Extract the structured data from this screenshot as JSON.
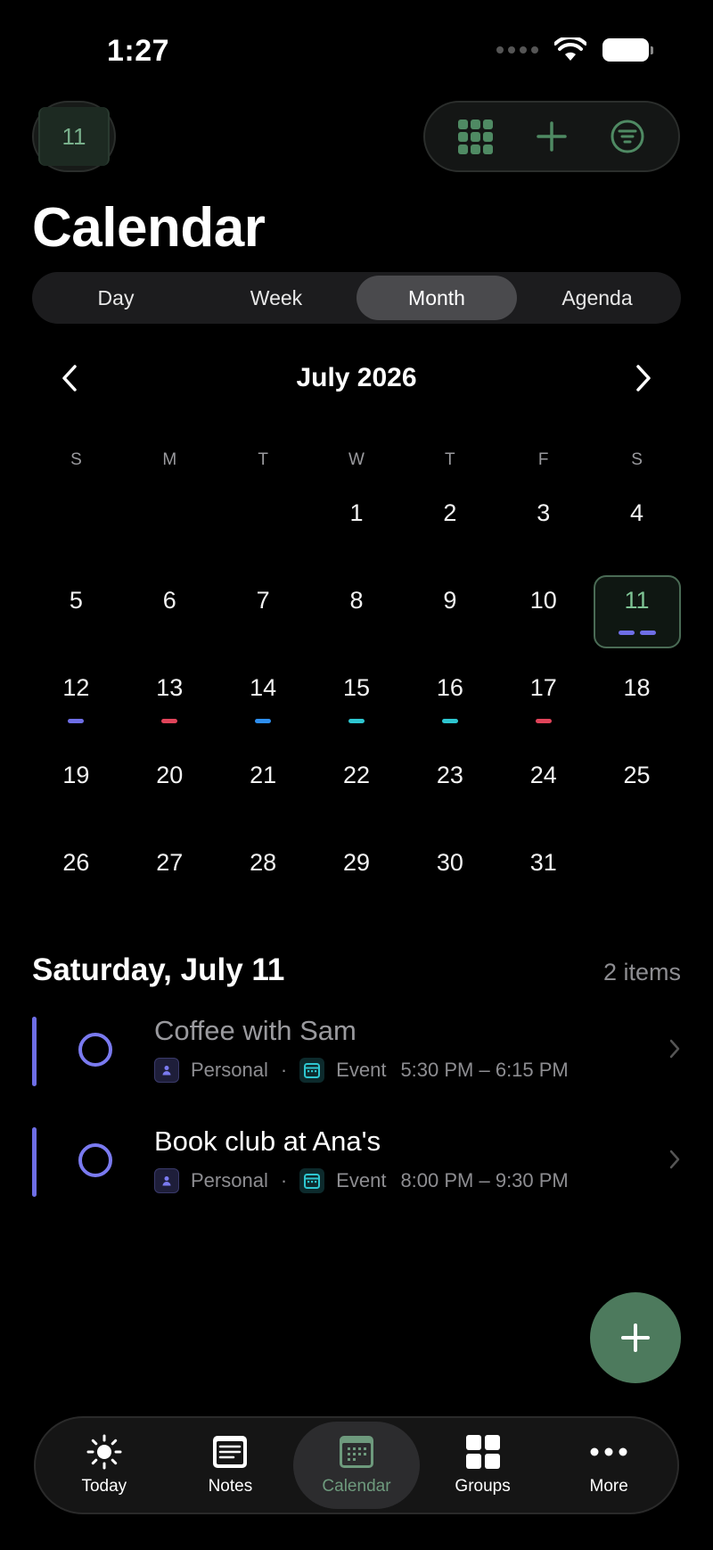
{
  "status_bar": {
    "time": "1:27"
  },
  "header": {
    "day_badge": "11"
  },
  "title": "Calendar",
  "view_tabs": [
    {
      "label": "Day",
      "active": false
    },
    {
      "label": "Week",
      "active": false
    },
    {
      "label": "Month",
      "active": true
    },
    {
      "label": "Agenda",
      "active": false
    }
  ],
  "calendar": {
    "month_label": "July 2026",
    "weekdays": [
      "S",
      "M",
      "T",
      "W",
      "T",
      "F",
      "S"
    ],
    "leading_blanks": 3,
    "days_in_month": 31,
    "selected_day": 11,
    "markers": {
      "11": [
        "#6e6ee6",
        "#6e6ee6"
      ],
      "12": [
        "#6e6ee6"
      ],
      "13": [
        "#e0445a"
      ],
      "14": [
        "#2e8ff0"
      ],
      "15": [
        "#2ec6d0"
      ],
      "16": [
        "#2ec6d0"
      ],
      "17": [
        "#e0445a"
      ]
    }
  },
  "day_section": {
    "heading": "Saturday, July 11",
    "count": "2 items",
    "events": [
      {
        "title": "Coffee with Sam",
        "muted": true,
        "calendar": "Personal",
        "type": "Event",
        "time": "5:30 PM – 6:15 PM"
      },
      {
        "title": "Book club at Ana's",
        "muted": false,
        "calendar": "Personal",
        "type": "Event",
        "time": "8:00 PM – 9:30 PM"
      }
    ]
  },
  "tab_bar": [
    {
      "label": "Today",
      "icon": "sun-icon",
      "active": false
    },
    {
      "label": "Notes",
      "icon": "notes-icon",
      "active": false
    },
    {
      "label": "Calendar",
      "icon": "calendar-icon",
      "active": true
    },
    {
      "label": "Groups",
      "icon": "grid-icon",
      "active": false
    },
    {
      "label": "More",
      "icon": "more-icon",
      "active": false
    }
  ],
  "colors": {
    "accent": "#4d7a5d",
    "event_bar": "#6e6ee6"
  }
}
